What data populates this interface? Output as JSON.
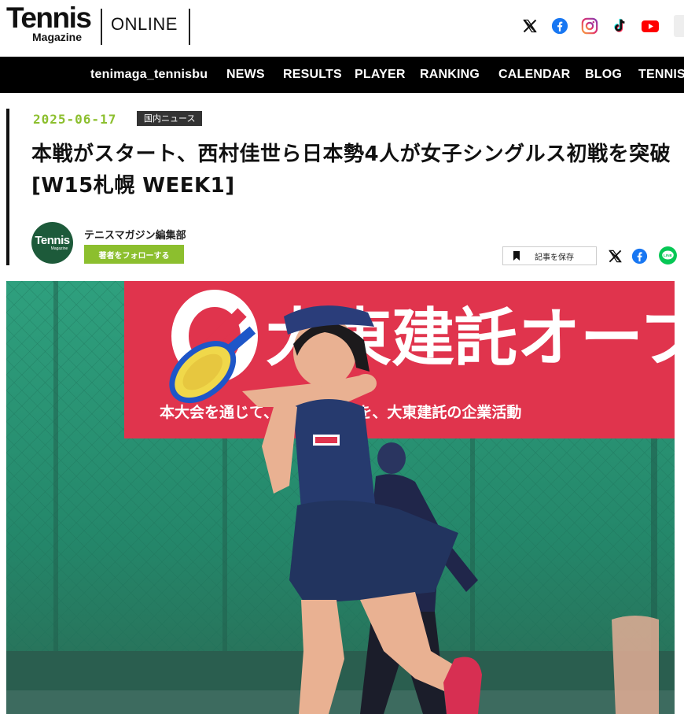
{
  "header": {
    "logo_main": "Tennis",
    "logo_sub": "Magazine",
    "logo_online": "ONLINE",
    "social": [
      {
        "icon": "x-icon"
      },
      {
        "icon": "facebook-icon",
        "color": "#1877f2"
      },
      {
        "icon": "instagram-icon"
      },
      {
        "icon": "tiktok-icon"
      },
      {
        "icon": "youtube-icon",
        "color": "#ff0000"
      }
    ]
  },
  "nav": {
    "items": [
      "tenimaga_tennisbu",
      "NEWS",
      "RESULTS",
      "PLAYER",
      "RANKING",
      "CALENDAR",
      "BLOG",
      "TENNIS"
    ]
  },
  "article": {
    "date": "2025-06-17",
    "category": "国内ニュース",
    "title": "本戦がスタート、西村佳世ら日本勢4人が女子シングルス初戦を突破 [W15札幌 WEEK1]",
    "author": {
      "avatar_main": "Tennis",
      "avatar_sub": "Magazine",
      "name": "テニスマガジン編集部",
      "follow_label": "著者をフォローする"
    },
    "save_label": "記事を保存",
    "share": [
      {
        "icon": "x-icon"
      },
      {
        "icon": "facebook-icon",
        "color": "#1877f2"
      },
      {
        "icon": "line-icon",
        "color": "#06c755"
      }
    ],
    "hero": {
      "banner_text": "大東建託オープ",
      "banner_subtext": "本大会を通じて、CO2の一部を、大東建託の企業活動",
      "accent_color": "#8cbf2e"
    }
  }
}
